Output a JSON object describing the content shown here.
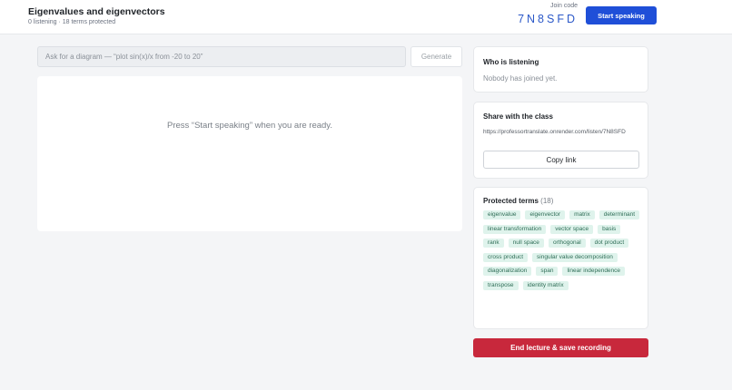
{
  "header": {
    "title": "Eigenvalues and eigenvectors",
    "stats": "0 listening · 18 terms protected",
    "join_label": "Join code",
    "join_code": "7N8SFD",
    "start_label": "Start speaking"
  },
  "diagram": {
    "placeholder": "Ask for a diagram — “plot sin(x)/x from -20 to 20”",
    "value": "",
    "generate_label": "Generate",
    "hint": "Press “Start speaking” when you are ready."
  },
  "listeners": {
    "title": "Who is listening",
    "empty_text": "Nobody has joined yet."
  },
  "share": {
    "title": "Share with the class",
    "url": "https://professortranslate.onrender.com/listen/7N8SFD",
    "copy_label": "Copy link"
  },
  "terms": {
    "title": "Protected terms",
    "count": "(18)",
    "items": [
      "eigenvalue",
      "eigenvector",
      "matrix",
      "determinant",
      "linear transformation",
      "vector space",
      "basis",
      "rank",
      "null space",
      "orthogonal",
      "dot product",
      "cross product",
      "singular value decomposition",
      "diagonalization",
      "span",
      "linear independence",
      "transpose",
      "identity matrix"
    ]
  },
  "end_label": "End lecture & save recording",
  "colors": {
    "primary": "#1f4fd8",
    "join_code": "#2b58c8",
    "danger": "#c8283c",
    "chip_bg": "#dff3ec",
    "chip_text": "#2f6e57"
  }
}
